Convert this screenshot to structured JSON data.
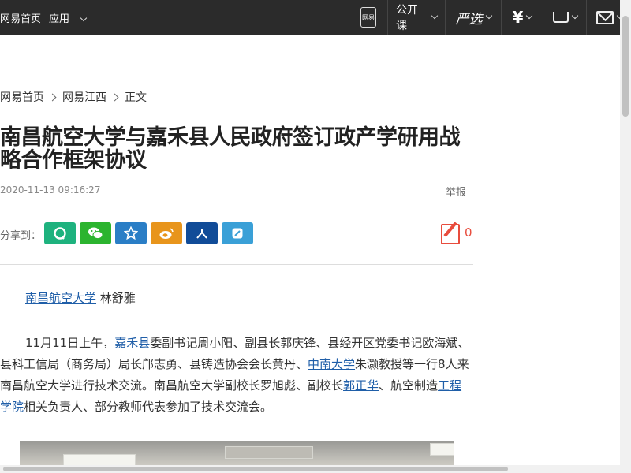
{
  "topbar": {
    "home_link": "网易首页",
    "apps_label": "应用",
    "phone_label": "网易",
    "open_course": "公开课",
    "yanxuan": "严选",
    "money_symbol": "¥",
    "cart_icon": "cart-icon",
    "mail_icon": "mail-icon"
  },
  "breadcrumb": {
    "items": [
      "网易首页",
      "网易江西",
      "正文"
    ]
  },
  "article": {
    "title": "南昌航空大学与嘉禾县人民政府签订政产学研用战略合作框架协议",
    "time": "2020-11-13 09:16:27",
    "report": "举报",
    "share_label": "分享到：",
    "comment_count": "0",
    "byline_link": "南昌航空大学",
    "byline_author": " 林舒雅",
    "para1": {
      "t1": "11月11日上午，",
      "l1": "嘉禾县",
      "t2": "委副书记周小阳、副县长郭庆锋、县经开区党委书记欧海斌、县科工信局（商务局）局长邝志勇、县铸造协会会长黄丹、",
      "l2": "中南大学",
      "t3": "朱灏教授等一行8人来南昌航空大学进行技术交流。南昌航空大学副校长罗旭彪、副校长",
      "l3": "郭正华",
      "t4": "、航空制造",
      "l4": "工程学院",
      "t5": "相关负责人、部分教师代表参加了技术交流会。"
    }
  },
  "share_buttons": [
    {
      "name": "qq-icon",
      "color": "#1eb27e"
    },
    {
      "name": "wechat-icon",
      "color": "#2cb42f"
    },
    {
      "name": "qzone-icon",
      "color": "#2a7ec6"
    },
    {
      "name": "weibo-icon",
      "color": "#e8951c"
    },
    {
      "name": "renren-icon",
      "color": "#114c98"
    },
    {
      "name": "note-icon",
      "color": "#3aa0d7"
    }
  ]
}
